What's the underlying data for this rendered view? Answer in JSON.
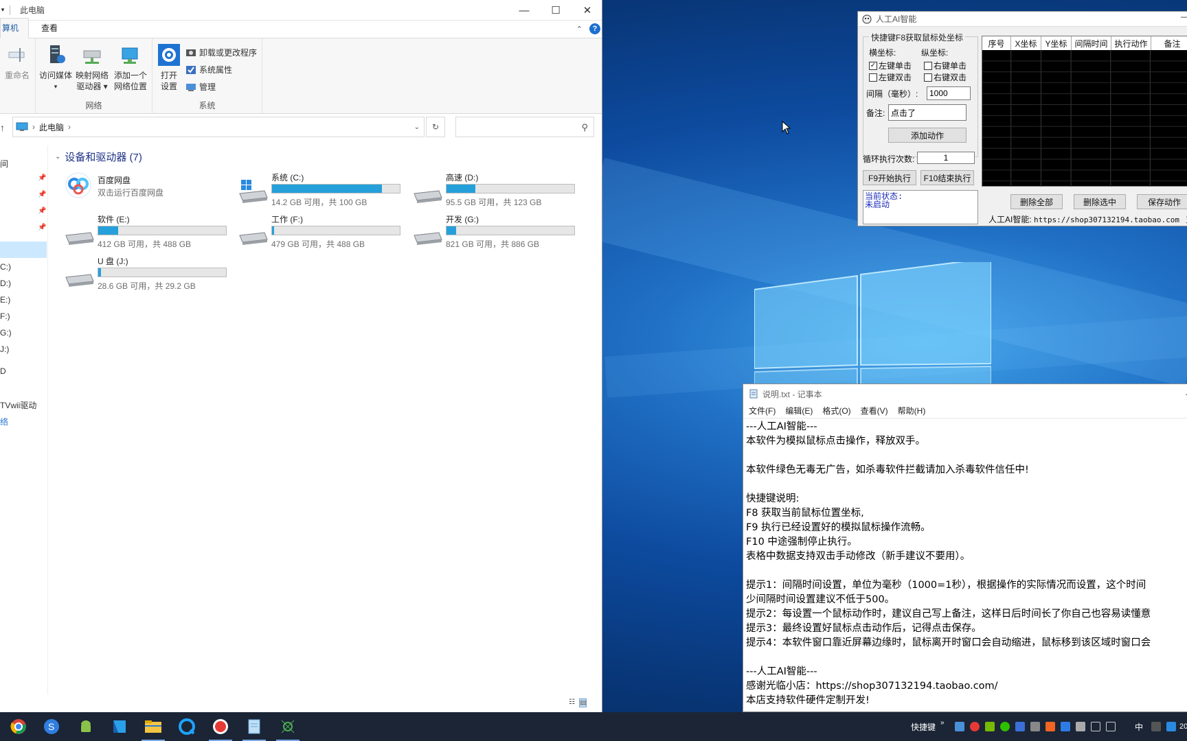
{
  "explorer": {
    "title": "此电脑",
    "tabs": [
      "算机",
      "查看"
    ],
    "ribbon": {
      "rename": "重命名",
      "access_media": "访问媒体",
      "map_drive_1": "映射网络",
      "map_drive_2": "驱动器",
      "add_location_1": "添加一个",
      "add_location_2": "网络位置",
      "open_settings_1": "打开",
      "open_settings_2": "设置",
      "uninstall": "卸载或更改程序",
      "system_props": "系统属性",
      "manage": "管理",
      "group_network": "网络",
      "group_system": "系统"
    },
    "address": "此电脑",
    "search_placeholder": "",
    "nav_items": [
      "间",
      "C:)",
      "D:)",
      "E:)",
      "F:)",
      "G:)",
      "J:)",
      "D",
      "TVwii驱动",
      "络"
    ],
    "section_title": "设备和驱动器 (7)",
    "baidu": {
      "name": "百度网盘",
      "sub": "双击运行百度网盘"
    },
    "drives": [
      {
        "name": "系统 (C:)",
        "free": "14.2 GB 可用，共 100 GB",
        "used_fraction": 0.858
      },
      {
        "name": "高速 (D:)",
        "free": "95.5 GB 可用，共 123 GB",
        "used_fraction": 0.224
      },
      {
        "name": "软件 (E:)",
        "free": "412 GB 可用，共 488 GB",
        "used_fraction": 0.156
      },
      {
        "name": "工作 (F:)",
        "free": "479 GB 可用，共 488 GB",
        "used_fraction": 0.018
      },
      {
        "name": "开发 (G:)",
        "free": "821 GB 可用，共 886 GB",
        "used_fraction": 0.073
      },
      {
        "name": "U 盘 (J:)",
        "free": "28.6 GB 可用，共 29.2 GB",
        "used_fraction": 0.02
      }
    ]
  },
  "ai_tool": {
    "title": "人工AI智能",
    "group_label": "快捷键F8获取鼠标处坐标",
    "x_label": "横坐标:",
    "y_label": "纵坐标:",
    "left_click": "左键单击",
    "left_double": "左键双击",
    "right_click": "右键单击",
    "right_double": "右键双击",
    "interval_label": "间隔（毫秒）:",
    "interval_value": "1000",
    "note_label": "备注:",
    "note_value": "点击了",
    "add_action": "添加动作",
    "loop_label": "循环执行次数:",
    "loop_value": "1",
    "start_btn": "F9开始执行",
    "stop_btn": "F10结束执行",
    "status_label": "当前状态:",
    "status_value": "未启动",
    "columns": [
      "序号",
      "X坐标",
      "Y坐标",
      "间隔时间",
      "执行动作",
      "备注"
    ],
    "delete_all": "删除全部",
    "delete_selected": "删除选中",
    "save_action": "保存动作",
    "footer_label": "人工AI智能:",
    "footer_url": "https://shop307132194.taobao.com",
    "footer_tail": "支"
  },
  "notepad": {
    "title": "说明.txt - 记事本",
    "menu": [
      "文件(F)",
      "编辑(E)",
      "格式(O)",
      "查看(V)",
      "帮助(H)"
    ],
    "lines": [
      "---人工AI智能---",
      "本软件为模拟鼠标点击操作，释放双手。",
      "",
      "本软件绿色无毒无广告，如杀毒软件拦截请加入杀毒软件信任中!",
      "",
      "快捷键说明:",
      "F8 获取当前鼠标位置坐标,",
      "F9 执行已经设置好的模拟鼠标操作流畅。",
      "F10 中途强制停止执行。",
      "表格中数据支持双击手动修改（新手建议不要用）。",
      "",
      "提示1：间隔时间设置，单位为毫秒（1000=1秒），根据操作的实际情况而设置，这个时间",
      "少间隔时间设置建议不低于500。",
      "提示2：每设置一个鼠标动作时，建议自己写上备注，这样日后时间长了你自己也容易读懂意",
      "提示3：最终设置好鼠标点击动作后，记得点击保存。",
      "提示4：本软件窗口靠近屏幕边缘时，鼠标离开时窗口会自动缩进，鼠标移到该区域时窗口会",
      "",
      "---人工AI智能---",
      "感谢光临小店：https://shop307132194.taobao.com/",
      "本店支持软件硬件定制开发!"
    ]
  },
  "taskbar": {
    "tray_text": "快捷键",
    "ime": "中",
    "clock": "20"
  }
}
